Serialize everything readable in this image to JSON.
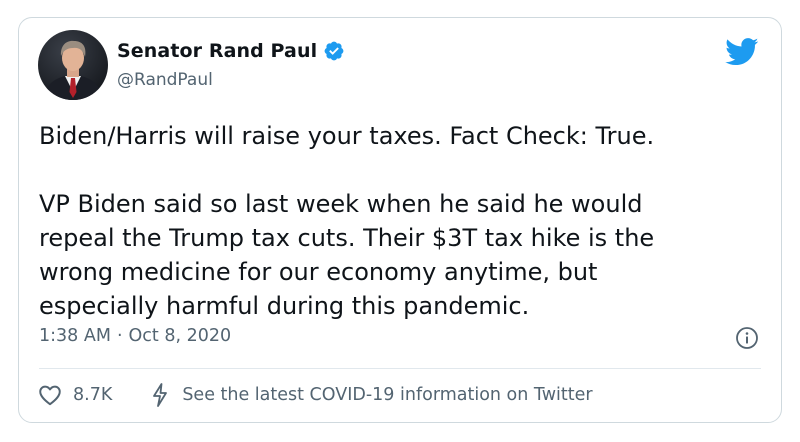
{
  "tweet": {
    "display_name": "Senator Rand Paul",
    "handle": "@RandPaul",
    "body_paragraphs": [
      "Biden/Harris will raise your taxes. Fact Check: True.",
      "VP Biden said so last week when he said he would\nrepeal the Trump tax cuts. Their $3T tax hike is the\nwrong medicine for our economy anytime, but\nespecially harmful during this pandemic."
    ],
    "time": "1:38 AM",
    "separator": "·",
    "date": "Oct 8, 2020",
    "likes": "8.7K",
    "covid_link": "See the latest COVID-19 information on Twitter"
  },
  "icons": {
    "verified": "verified-badge-icon",
    "logo": "twitter-bird-icon",
    "info": "info-icon",
    "like": "heart-icon",
    "covid": "lightning-bolt-icon"
  },
  "colors": {
    "brand_blue": "#1d9bf0",
    "text_primary": "#0f1419",
    "text_secondary": "#536471",
    "border": "#cfd9de"
  }
}
